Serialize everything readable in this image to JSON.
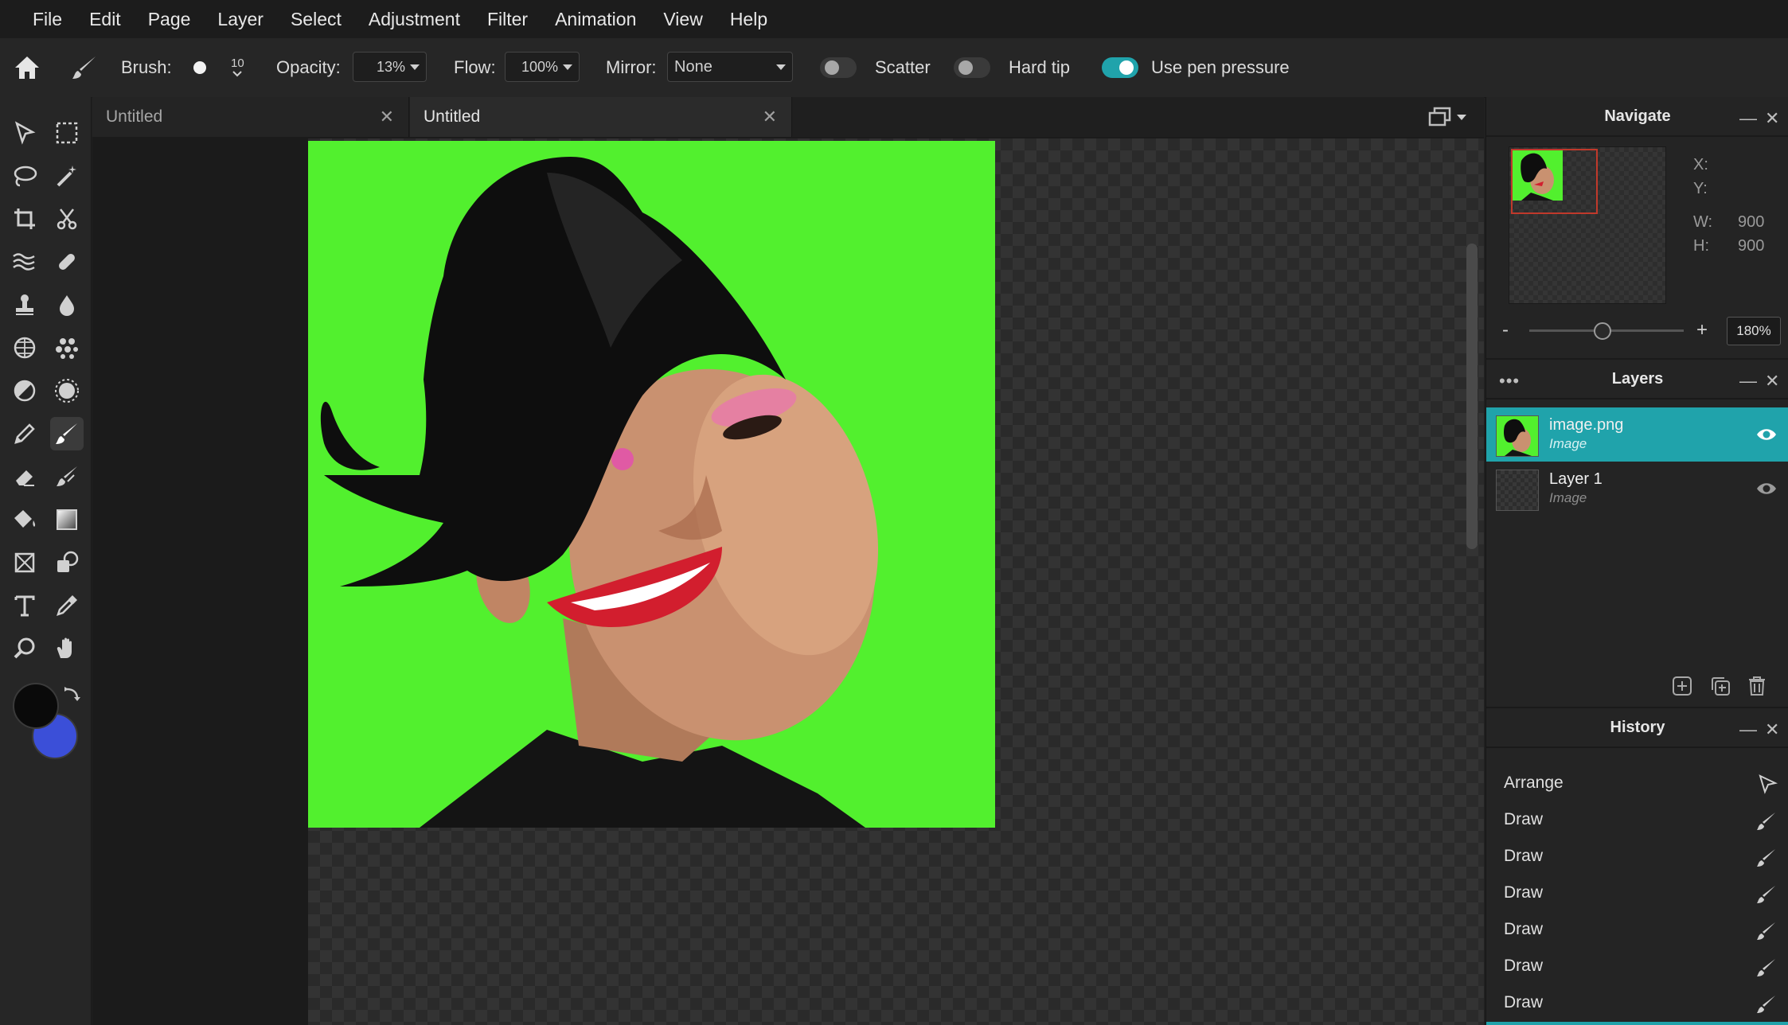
{
  "menu": {
    "items": [
      "File",
      "Edit",
      "Page",
      "Layer",
      "Select",
      "Adjustment",
      "Filter",
      "Animation",
      "View",
      "Help"
    ]
  },
  "toolbar": {
    "brush_label": "Brush:",
    "brush_size": "10",
    "opacity_label": "Opacity:",
    "opacity_value": "13%",
    "flow_label": "Flow:",
    "flow_value": "100%",
    "mirror_label": "Mirror:",
    "mirror_value": "None",
    "scatter_label": "Scatter",
    "scatter_on": false,
    "hardtip_label": "Hard tip",
    "hardtip_on": false,
    "pressure_label": "Use pen pressure",
    "pressure_on": true
  },
  "tools": [
    "move-icon",
    "marquee-icon",
    "lasso-icon",
    "magic-wand-icon",
    "crop-icon",
    "cut-icon",
    "liquify-icon",
    "healing-icon",
    "stamp-icon",
    "blur-drop-icon",
    "sponge-icon",
    "dots-icon",
    "dodge-icon",
    "sharpen-icon",
    "pencil-icon",
    "brush-icon",
    "eraser-icon",
    "smudge-icon",
    "fill-bucket-icon",
    "gradient-icon",
    "transform-icon",
    "shapes-icon",
    "text-icon",
    "eyedropper-icon",
    "zoom-icon",
    "hand-icon"
  ],
  "colors": {
    "foreground": "#0a0a0a",
    "background": "#3b4fd8",
    "accent": "#20a3ab",
    "canvas_fill": "#52f02e"
  },
  "tabs": [
    {
      "label": "Untitled",
      "active": false
    },
    {
      "label": "Untitled",
      "active": true
    }
  ],
  "navigate": {
    "title": "Navigate",
    "x_label": "X:",
    "y_label": "Y:",
    "w_label": "W:",
    "w_value": "900",
    "h_label": "H:",
    "h_value": "900",
    "zoom_minus": "-",
    "zoom_plus": "+",
    "zoom_value": "180%",
    "zoom_slider_fraction": 0.47
  },
  "layers": {
    "title": "Layers",
    "items": [
      {
        "name": "image.png",
        "type": "Image",
        "selected": true
      },
      {
        "name": "Layer 1",
        "type": "Image",
        "selected": false
      }
    ]
  },
  "history": {
    "title": "History",
    "items": [
      {
        "label": "Arrange",
        "icon": "arrow-icon"
      },
      {
        "label": "Draw",
        "icon": "brush-icon"
      },
      {
        "label": "Draw",
        "icon": "brush-icon"
      },
      {
        "label": "Draw",
        "icon": "brush-icon"
      },
      {
        "label": "Draw",
        "icon": "brush-icon"
      },
      {
        "label": "Draw",
        "icon": "brush-icon"
      },
      {
        "label": "Draw",
        "icon": "brush-icon"
      }
    ]
  }
}
